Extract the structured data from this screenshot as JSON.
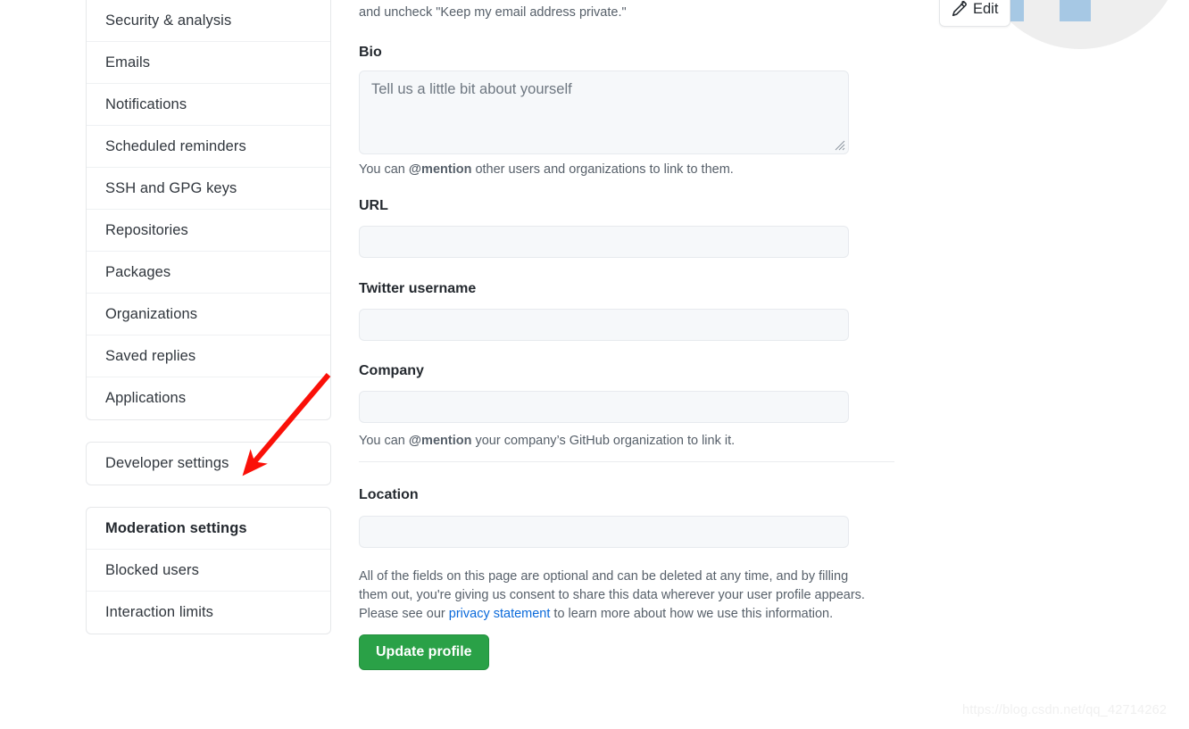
{
  "sidebar": {
    "primary_items": [
      {
        "label": "",
        "partial": true
      },
      {
        "label": "Security & analysis"
      },
      {
        "label": "Emails"
      },
      {
        "label": "Notifications"
      },
      {
        "label": "Scheduled reminders"
      },
      {
        "label": "SSH and GPG keys"
      },
      {
        "label": "Repositories"
      },
      {
        "label": "Packages"
      },
      {
        "label": "Organizations"
      },
      {
        "label": "Saved replies"
      },
      {
        "label": "Applications"
      }
    ],
    "developer_item": {
      "label": "Developer settings"
    },
    "moderation_items": [
      {
        "label": "Moderation settings",
        "bold": true
      },
      {
        "label": "Blocked users"
      },
      {
        "label": "Interaction limits"
      }
    ]
  },
  "main": {
    "email_note": "and uncheck \"Keep my email address private.\"",
    "bio": {
      "label": "Bio",
      "placeholder": "Tell us a little bit about yourself",
      "value": "",
      "help_prefix": "You can ",
      "help_bold": "@mention",
      "help_suffix": " other users and organizations to link to them."
    },
    "url": {
      "label": "URL",
      "value": "",
      "placeholder": ""
    },
    "twitter": {
      "label": "Twitter username",
      "value": "",
      "placeholder": ""
    },
    "company": {
      "label": "Company",
      "value": "",
      "placeholder": "",
      "help_prefix": "You can ",
      "help_bold": "@mention",
      "help_suffix": " your company’s GitHub organization to link it."
    },
    "location": {
      "label": "Location",
      "value": "",
      "placeholder": ""
    },
    "consent": {
      "line1": "All of the fields on this page are optional and can be deleted at any time, and by filling",
      "line2": "them out, you're giving us consent to share this data wherever your user profile appears.",
      "line3_prefix": "Please see our ",
      "link": "privacy statement",
      "line3_suffix": " to learn more about how we use this information."
    },
    "submit_label": "Update profile"
  },
  "avatar": {
    "edit_label": "Edit",
    "edit_icon": "pencil-icon"
  },
  "watermark": "https://blog.csdn.net/qq_42714262",
  "colors": {
    "accent_green": "#2aa147",
    "link_blue": "#0969da",
    "arrow_red": "#fa1008",
    "input_bg": "#f6f8fa",
    "avatar_blue": "#a6c8e4"
  }
}
